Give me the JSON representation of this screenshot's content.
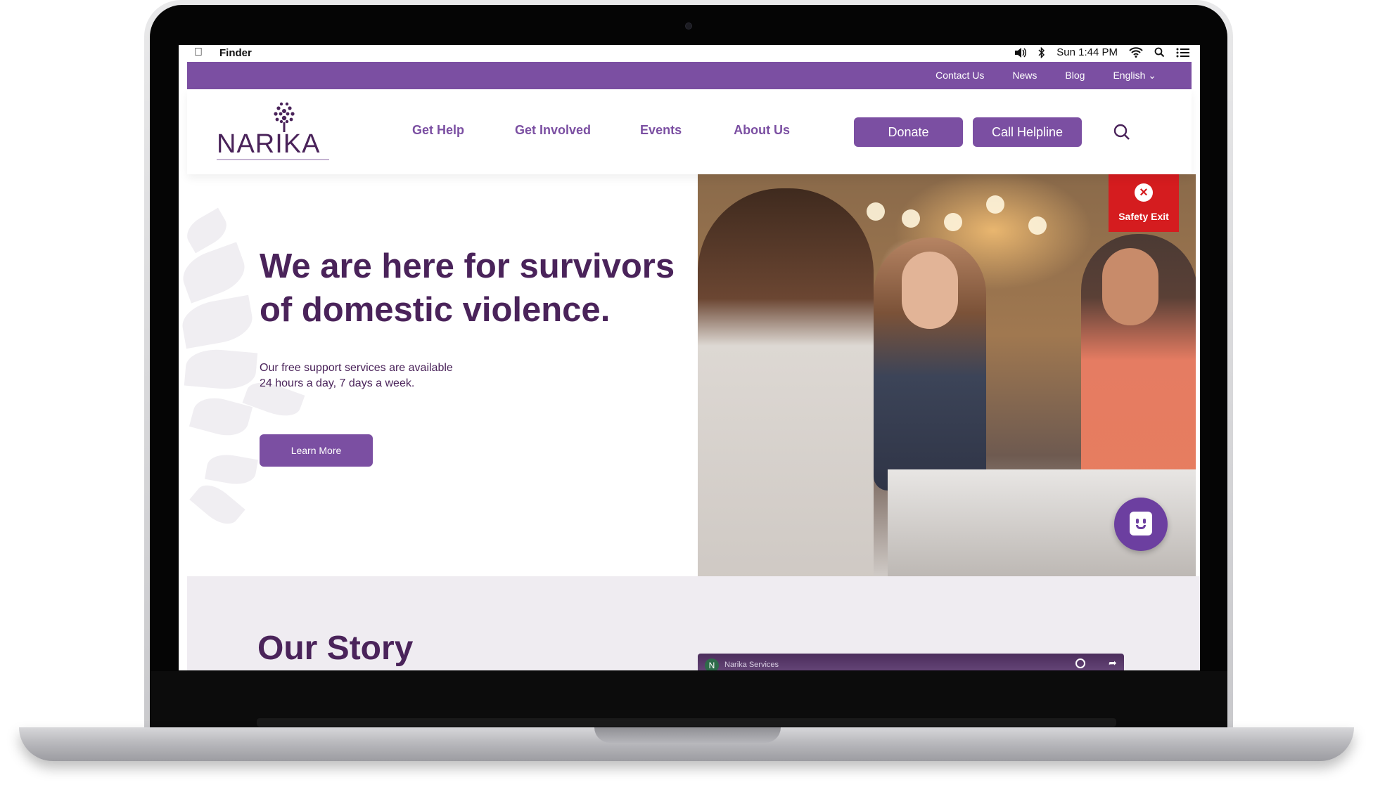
{
  "os_menubar": {
    "app_name": "Finder",
    "clock": "Sun 1:44 PM"
  },
  "site": {
    "utility_links": [
      "Contact Us",
      "News",
      "Blog",
      "English"
    ],
    "logo_text": "NARIKA",
    "nav": [
      "Get Help",
      "Get Involved",
      "Events",
      "About Us"
    ],
    "donate_label": "Donate",
    "helpline_label": "Call Helpline",
    "hero": {
      "title": "We are here for survivors of domestic violence.",
      "subtitle_line1": "Our free support services are available",
      "subtitle_line2": "24 hours a day, 7 days a week.",
      "cta_label": "Learn More"
    },
    "safety_exit_label": "Safety Exit",
    "story_title": "Our Story",
    "video": {
      "channel_initial": "N",
      "title": "Narika Services"
    }
  },
  "colors": {
    "brand_purple": "#7b4fa2",
    "dark_purple": "#4a235a",
    "safety_red": "#d51c1f",
    "section_bg": "#efecf1"
  }
}
